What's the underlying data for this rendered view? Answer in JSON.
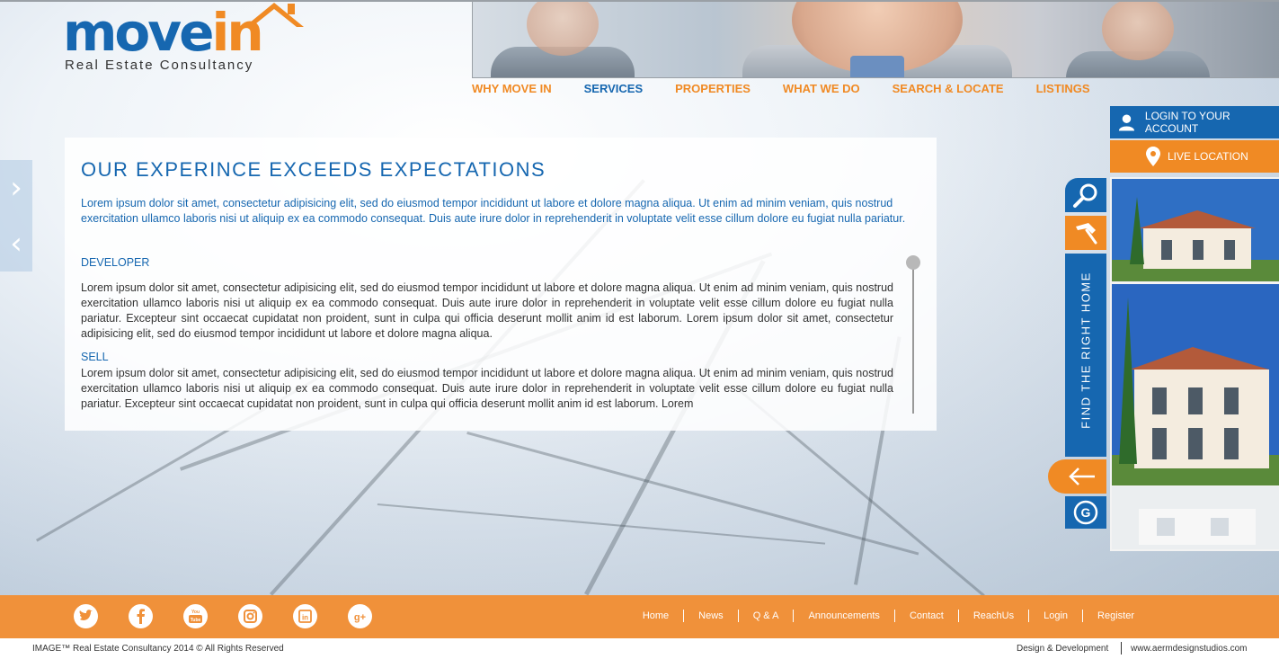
{
  "brand": {
    "logo_word_a": "move",
    "logo_word_b": "in",
    "tagline": "Real Estate Consultancy"
  },
  "nav": {
    "items": [
      "WHY MOVE IN",
      "SERVICES",
      "PROPERTIES",
      "WHAT WE DO",
      "SEARCH & LOCATE",
      "LISTINGS"
    ],
    "active": "SERVICES"
  },
  "main": {
    "title": "OUR EXPERINCE EXCEEDS EXPECTATIONS",
    "intro": "Lorem ipsum dolor sit amet, consectetur adipisicing elit, sed do eiusmod tempor incididunt ut labore et dolore magna aliqua. Ut enim ad minim veniam, quis nostrud exercitation ullamco laboris nisi ut aliquip ex ea commodo consequat. Duis aute irure dolor in reprehenderit in voluptate velit esse cillum dolore eu fugiat nulla pariatur.",
    "sections": [
      {
        "heading": "DEVELOPER",
        "body": "Lorem ipsum dolor sit amet, consectetur adipisicing elit, sed do eiusmod tempor incididunt ut labore et dolore magna aliqua. Ut enim ad minim veniam, quis nostrud exercitation ullamco laboris nisi ut aliquip ex ea commodo consequat. Duis aute irure dolor in reprehenderit in voluptate velit esse cillum dolore eu fugiat nulla pariatur. Excepteur sint occaecat cupidatat non proident, sunt in culpa qui officia deserunt mollit anim id est laborum. Lorem ipsum dolor sit amet, consectetur adipisicing elit, sed do eiusmod tempor incididunt ut labore et dolore magna aliqua."
      },
      {
        "heading": "SELL",
        "body": "Lorem ipsum dolor sit amet, consectetur adipisicing elit, sed do eiusmod tempor incididunt ut labore et dolore magna aliqua. Ut enim ad minim veniam, quis nostrud exercitation ullamco laboris nisi ut aliquip ex ea commodo consequat. Duis aute irure dolor in reprehenderit in voluptate velit esse cillum dolore eu fugiat nulla pariatur. Excepteur sint occaecat cupidatat non proident, sunt in culpa qui officia deserunt mollit anim id est laborum. Lorem"
      }
    ]
  },
  "side_panel": {
    "login_label": "LOGIN TO YOUR ACCOUNT",
    "live_location_label": "LIVE LOCATION",
    "find_home_label": "FIND THE RIGHT HOME"
  },
  "footer": {
    "social_icons": [
      "twitter-icon",
      "facebook-icon",
      "youtube-icon",
      "instagram-icon",
      "linkedin-icon",
      "google-plus-icon"
    ],
    "links": [
      "Home",
      "News",
      "Q & A",
      "Announcements",
      "Contact",
      "ReachUs",
      "Login",
      "Register"
    ],
    "copyright": "IMAGE™ Real Estate Consultancy 2014 © All Rights Reserved",
    "design_credit": "Design & Development",
    "design_url": "www.aermdesignstudios.com"
  },
  "colors": {
    "brand_blue": "#1667b0",
    "brand_orange": "#f08a24",
    "footer_orange": "#f0913a"
  }
}
